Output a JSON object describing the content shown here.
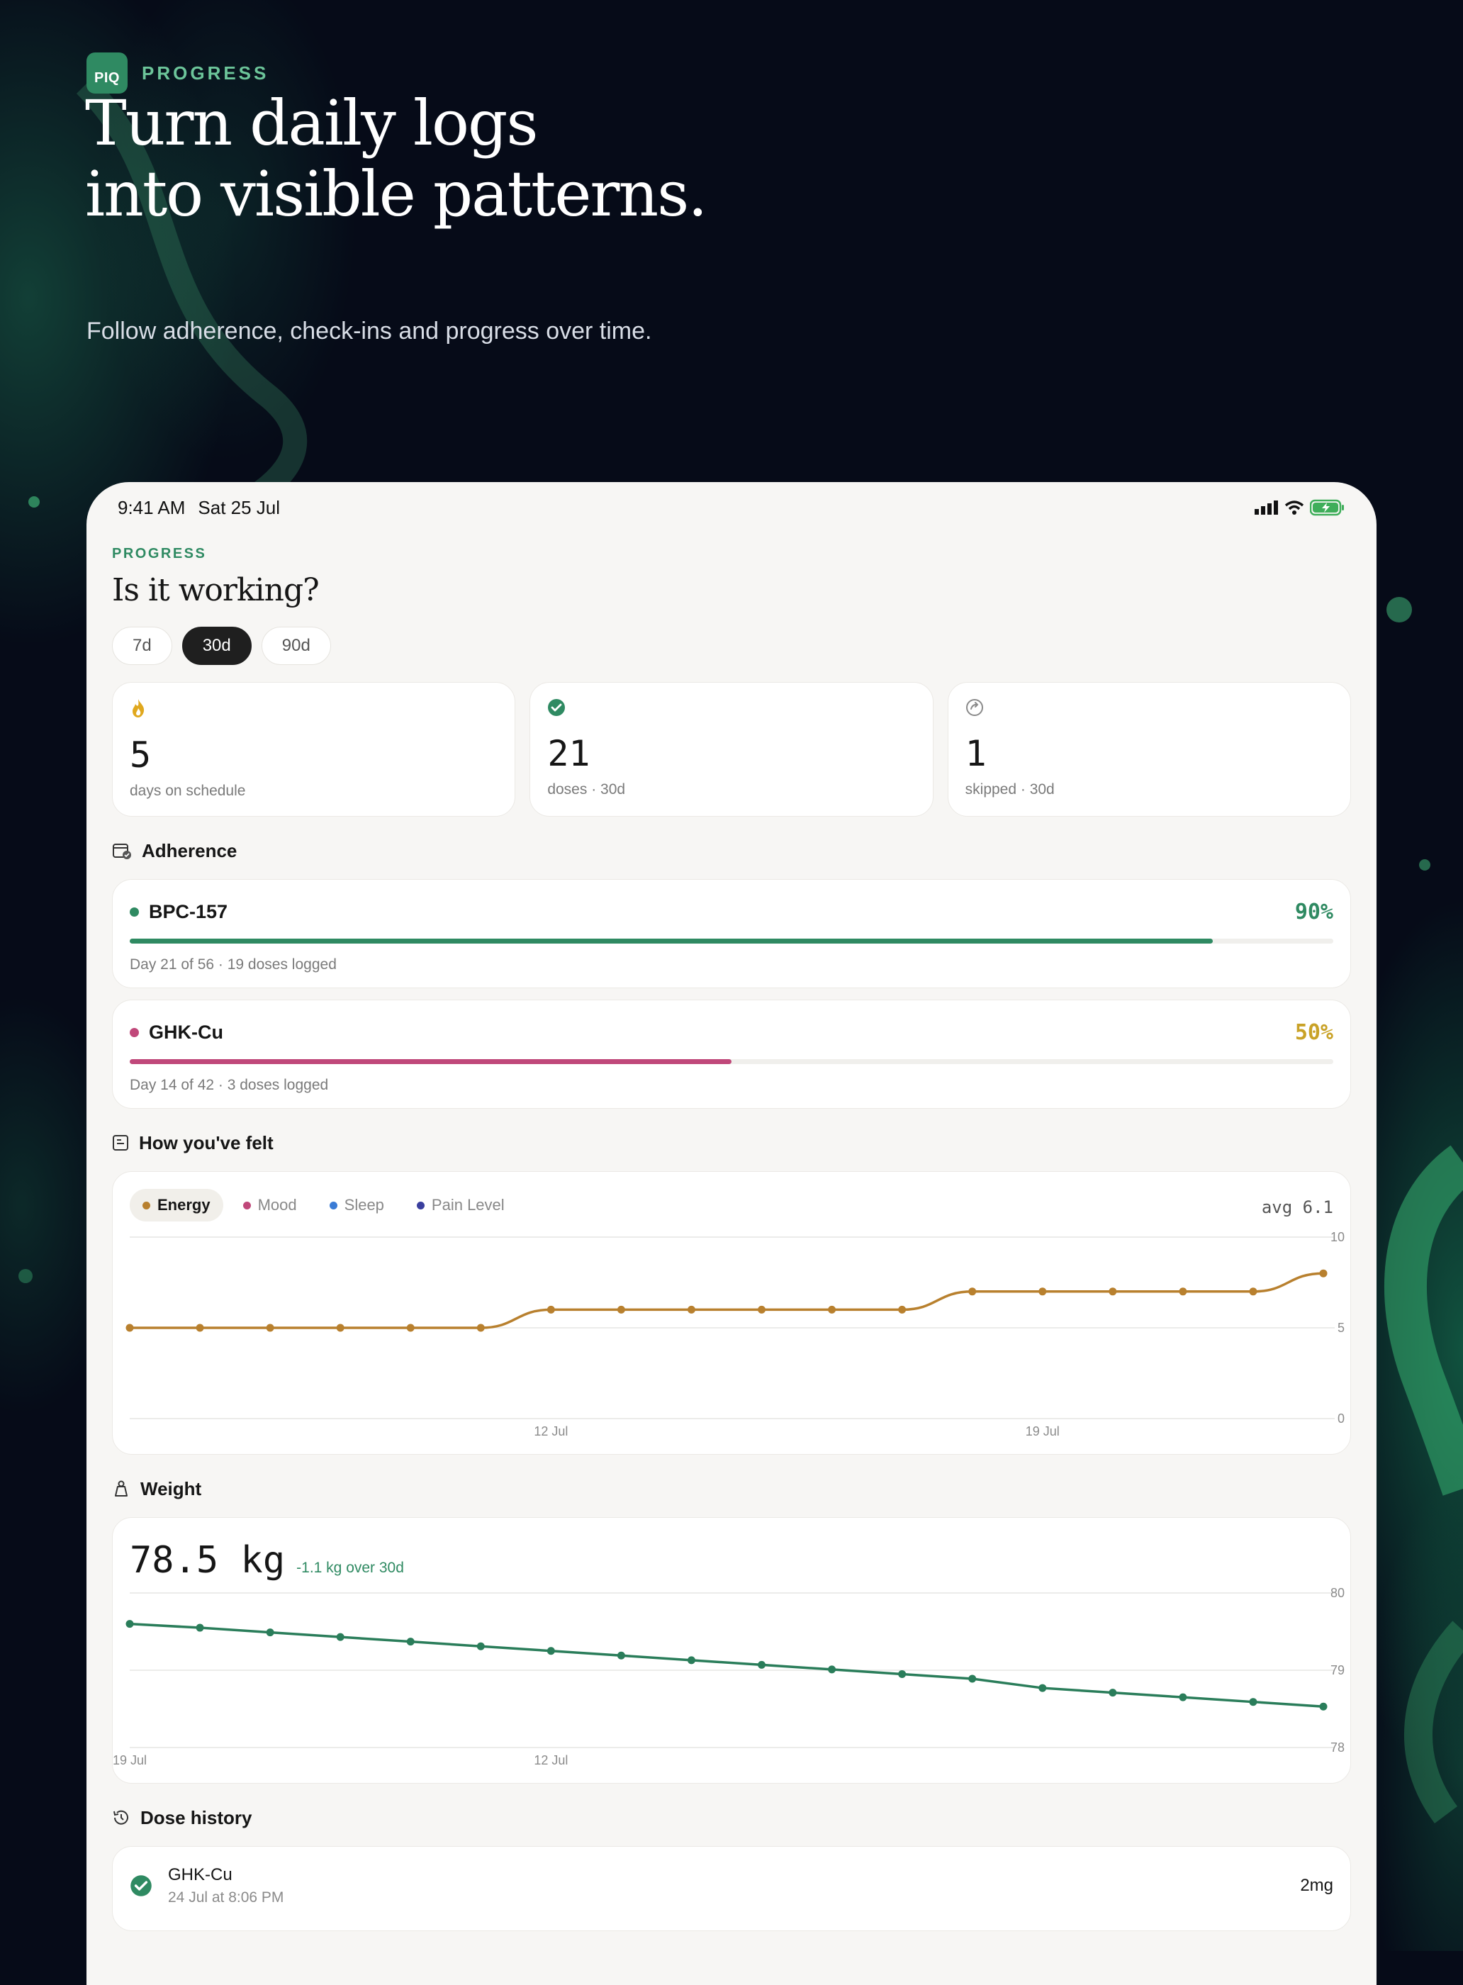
{
  "hero": {
    "logo_text": "PIQ",
    "label": "PROGRESS",
    "title_line1": "Turn daily logs",
    "title_line2": "into visible patterns.",
    "subtitle": "Follow adherence, check-ins and progress over time."
  },
  "status_bar": {
    "time": "9:41 AM",
    "date": "Sat 25 Jul"
  },
  "page": {
    "eyebrow": "PROGRESS",
    "title": "Is it working?"
  },
  "range_pills": [
    {
      "label": "7d",
      "active": false
    },
    {
      "label": "30d",
      "active": true
    },
    {
      "label": "90d",
      "active": false
    }
  ],
  "stats": [
    {
      "icon": "flame-icon",
      "value": "5",
      "label": "days on schedule"
    },
    {
      "icon": "check-circle-icon",
      "value": "21",
      "label": "doses · 30d"
    },
    {
      "icon": "skip-icon",
      "value": "1",
      "label": "skipped · 30d"
    }
  ],
  "sections": {
    "adherence": "Adherence",
    "felt": "How you've felt",
    "weight": "Weight",
    "dose_history": "Dose history"
  },
  "adherence": [
    {
      "name": "BPC-157",
      "percent_text": "90%",
      "percent": 0.9,
      "color": "#2f8a62",
      "pct_color": "#2f8a62",
      "detail": "Day 21 of 56 · 19 doses logged"
    },
    {
      "name": "GHK-Cu",
      "percent_text": "50%",
      "percent": 0.5,
      "color": "#c0487a",
      "pct_color": "#c9a227",
      "detail": "Day 14 of 42 · 3 doses logged"
    }
  ],
  "felt": {
    "legend": [
      {
        "label": "Energy",
        "color": "#b8802e",
        "active": true
      },
      {
        "label": "Mood",
        "color": "#c0487a",
        "active": false
      },
      {
        "label": "Sleep",
        "color": "#3a7bd5",
        "active": false
      },
      {
        "label": "Pain Level",
        "color": "#3a3f9e",
        "active": false
      }
    ],
    "avg_text": "avg 6.1"
  },
  "weight": {
    "value": "78.5 kg",
    "delta": "-1.1 kg over 30d"
  },
  "dose_history": [
    {
      "name": "GHK-Cu",
      "time": "24 Jul at 8:06 PM",
      "amount": "2mg"
    }
  ],
  "chart_data": [
    {
      "type": "line",
      "series": [
        {
          "name": "Energy",
          "color": "#b8802e",
          "x": [
            "6 Jul",
            "7 Jul",
            "8 Jul",
            "9 Jul",
            "10 Jul",
            "11 Jul",
            "12 Jul",
            "13 Jul",
            "14 Jul",
            "15 Jul",
            "16 Jul",
            "17 Jul",
            "18 Jul",
            "19 Jul",
            "20 Jul",
            "21 Jul",
            "22 Jul",
            "23 Jul"
          ],
          "values": [
            5,
            5,
            5,
            5,
            5,
            5,
            6,
            6,
            6,
            6,
            6,
            6,
            7,
            7,
            7,
            7,
            7,
            8
          ]
        }
      ],
      "x_ticks": [
        "12 Jul",
        "19 Jul"
      ],
      "y_ticks": [
        0,
        5,
        10
      ],
      "ylim": [
        0,
        10
      ]
    },
    {
      "type": "line",
      "series": [
        {
          "name": "",
          "color": "#2a7d5a",
          "x": [
            "6 Jul",
            "7 Jul",
            "8 Jul",
            "9 Jul",
            "10 Jul",
            "11 Jul",
            "12 Jul",
            "13 Jul",
            "14 Jul",
            "15 Jul",
            "16 Jul",
            "17 Jul",
            "18 Jul",
            "20 Jul",
            "21 Jul",
            "22 Jul",
            "23 Jul",
            "24 Jul"
          ],
          "values": [
            79.6,
            79.55,
            79.49,
            79.43,
            79.37,
            79.31,
            79.25,
            79.19,
            79.13,
            79.07,
            79.01,
            78.95,
            78.89,
            78.77,
            78.71,
            78.65,
            78.59,
            78.53
          ]
        }
      ],
      "x_ticks": [
        "12 Jul",
        "19 Jul"
      ],
      "y_ticks": [
        78,
        79,
        80
      ],
      "ylim": [
        78,
        80
      ]
    }
  ]
}
